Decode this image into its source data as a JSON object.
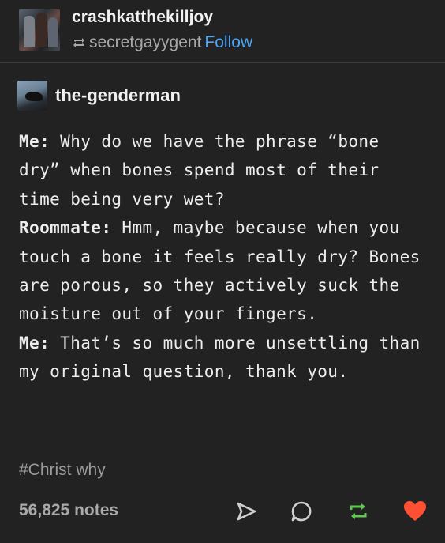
{
  "header": {
    "username": "crashkatthekilljoy",
    "reblogged_from": "secretgayygent",
    "follow_label": "Follow",
    "reblog_icon": "reblog-icon"
  },
  "source": {
    "username": "the-genderman"
  },
  "post": {
    "lines": [
      {
        "speaker": "Me:",
        "text": " Why do we have the phrase “bone dry” when bones spend most of their time being very wet?"
      },
      {
        "speaker": "Roommate:",
        "text": " Hmm, maybe because when you touch a bone it feels really dry? Bones are porous, so they actively suck the moisture out of your fingers."
      },
      {
        "speaker": "Me:",
        "text": " That’s so much more unsettling than my original question, thank you."
      }
    ]
  },
  "tags": [
    "#Christ why"
  ],
  "footer": {
    "notes": "56,825 notes",
    "icons": [
      "share-icon",
      "reply-icon",
      "reblog-icon",
      "like-icon"
    ]
  },
  "colors": {
    "background": "#222222",
    "follow": "#4ea4f2",
    "reblog_green": "#5dcc4e",
    "like_red": "#ff5033",
    "muted": "#a8a8a8"
  }
}
